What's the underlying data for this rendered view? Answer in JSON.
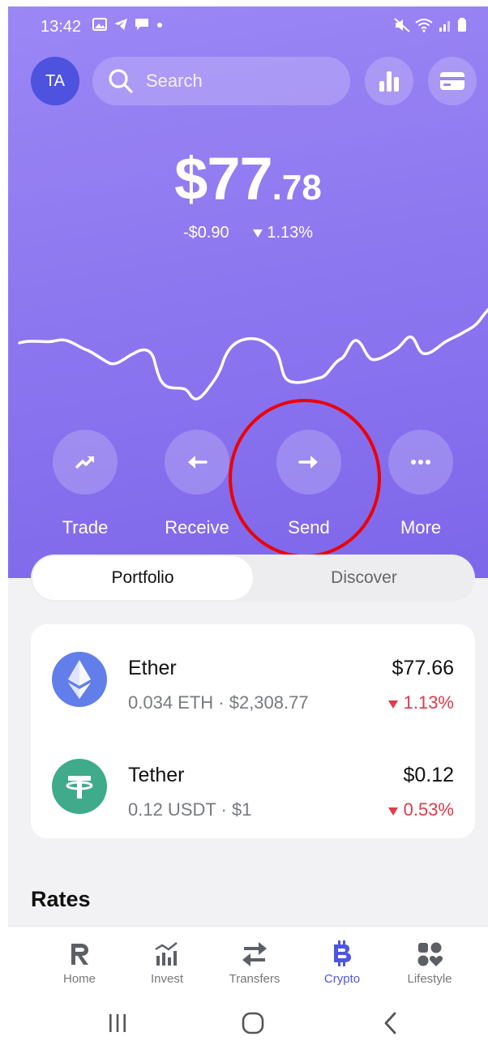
{
  "status_bar": {
    "time": "13:42"
  },
  "header": {
    "avatar_initials": "TA",
    "search_placeholder": "Search"
  },
  "balance": {
    "integer_part": "$77",
    "decimal_part": ".78",
    "change_amount": "-$0.90",
    "change_percent": "1.13%"
  },
  "colors": {
    "hero_gradient_top": "#9b87f5",
    "hero_gradient_bottom": "#7d67ea",
    "accent": "#4d57dd",
    "negative": "#e03a4a",
    "annotation": "#ee0000"
  },
  "actions": [
    {
      "label": "Trade",
      "icon": "trend-up-icon"
    },
    {
      "label": "Receive",
      "icon": "arrow-left-icon"
    },
    {
      "label": "Send",
      "icon": "arrow-right-icon"
    },
    {
      "label": "More",
      "icon": "more-dots-icon"
    }
  ],
  "tabs": {
    "portfolio": "Portfolio",
    "discover": "Discover",
    "selected": "Portfolio"
  },
  "assets": [
    {
      "name": "Ether",
      "detail": "0.034 ETH · $2,308.77",
      "value": "$77.66",
      "change": "1.13%",
      "icon": "ethereum-icon"
    },
    {
      "name": "Tether",
      "detail": "0.12 USDT · $1",
      "value": "$0.12",
      "change": "0.53%",
      "icon": "tether-icon"
    }
  ],
  "section": {
    "rates_title": "Rates"
  },
  "bottom_nav": [
    {
      "label": "Home",
      "icon": "revolut-r-icon"
    },
    {
      "label": "Invest",
      "icon": "invest-chart-icon"
    },
    {
      "label": "Transfers",
      "icon": "transfer-arrows-icon"
    },
    {
      "label": "Crypto",
      "icon": "bitcoin-icon",
      "active": true
    },
    {
      "label": "Lifestyle",
      "icon": "lifestyle-icon"
    }
  ]
}
